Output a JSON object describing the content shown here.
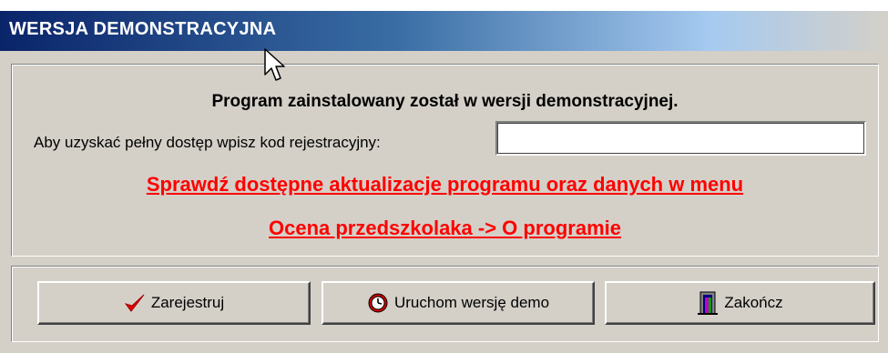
{
  "window": {
    "title": "WERSJA DEMONSTRACYJNA"
  },
  "main": {
    "heading": "Program zainstalowany został w wersji demonstracyjnej.",
    "registration_label": "Aby uzyskać pełny dostęp wpisz kod rejestracyjny:",
    "registration_value": "",
    "update_link_line1": "Sprawdź dostępne aktualizacje programu oraz danych w menu",
    "update_link_line2": "Ocena przedszkolaka -> O programie",
    "link_color": "#ff0000"
  },
  "buttons": {
    "register": {
      "label": "Zarejestruj",
      "icon": "checkmark-icon"
    },
    "demo": {
      "label": "Uruchom wersję demo",
      "icon": "clock-icon"
    },
    "exit": {
      "label": "Zakończ",
      "icon": "door-exit-icon"
    }
  },
  "colors": {
    "titlebar_start": "#0a246a",
    "titlebar_end": "#a6caf0",
    "dialog_bg": "#d4d0c8"
  }
}
